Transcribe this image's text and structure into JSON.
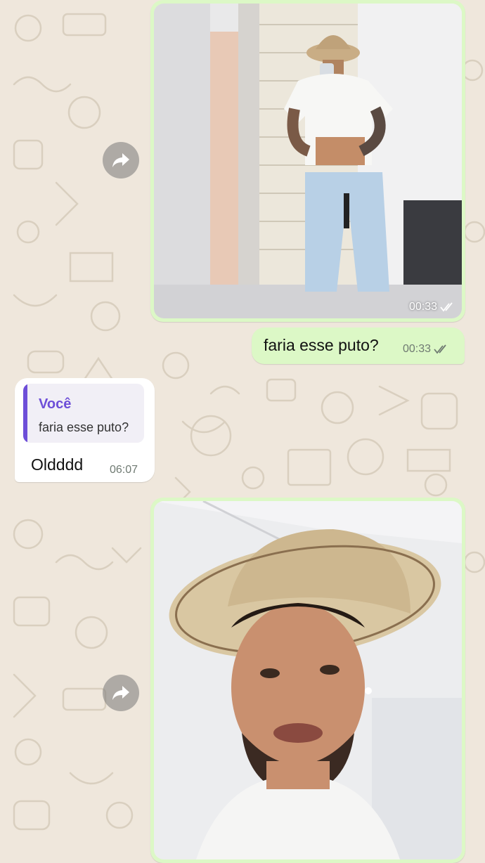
{
  "colors": {
    "wallpaper": "#efe7dc",
    "outgoing_bubble": "#dcf8c6",
    "incoming_bubble": "#ffffff",
    "quote_accent": "#6d4ed8",
    "timestamp": "#6f7a72"
  },
  "messages": [
    {
      "type": "image",
      "direction": "outgoing",
      "description_icon": "mirror-selfie-photo",
      "time": "00:33",
      "status_icon": "double-check-icon"
    },
    {
      "type": "text",
      "direction": "outgoing",
      "text": "faria esse puto?",
      "time": "00:33",
      "status_icon": "double-check-icon"
    },
    {
      "type": "text",
      "direction": "incoming",
      "reply_to": {
        "author": "Você",
        "text": "faria esse puto?"
      },
      "text": "Oldddd",
      "time": "06:07"
    },
    {
      "type": "image",
      "direction": "outgoing",
      "description_icon": "cowboy-hat-selfie-photo"
    }
  ],
  "icons": {
    "forward": "forward-arrow-icon",
    "read_receipt": "double-check-icon"
  }
}
